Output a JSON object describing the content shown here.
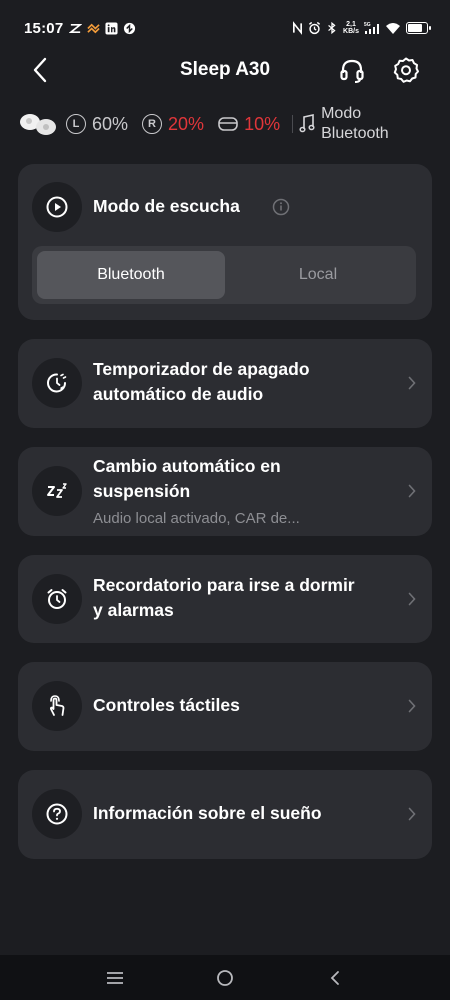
{
  "status": {
    "time": "15:07",
    "net_speed_top": "2,1",
    "net_speed_bottom": "KB/s",
    "battery_level": 0.85
  },
  "header": {
    "title": "Sleep A30"
  },
  "battery": {
    "left_label": "L",
    "left_value": "60%",
    "right_label": "R",
    "right_value": "20%",
    "case_value": "10%",
    "mode_line1": "Modo",
    "mode_line2": "Bluetooth"
  },
  "listening_mode": {
    "title": "Modo de escucha",
    "options": [
      "Bluetooth",
      "Local"
    ],
    "selected": "Bluetooth"
  },
  "menu": {
    "timer": {
      "line1": "Temporizador de apagado",
      "line2": "automático de audio"
    },
    "auto_switch": {
      "line1": "Cambio automático en",
      "line2": "suspensión",
      "subtitle": "Audio local activado, CAR de..."
    },
    "reminder": {
      "line1": "Recordatorio para irse a dormir",
      "line2": "y alarmas"
    },
    "touch": {
      "title": "Controles táctiles"
    },
    "sleep_info": {
      "title": "Información sobre el sueño"
    }
  },
  "colors": {
    "background": "#1c1d21",
    "card": "#2c2d32",
    "warning": "#e0363a"
  }
}
